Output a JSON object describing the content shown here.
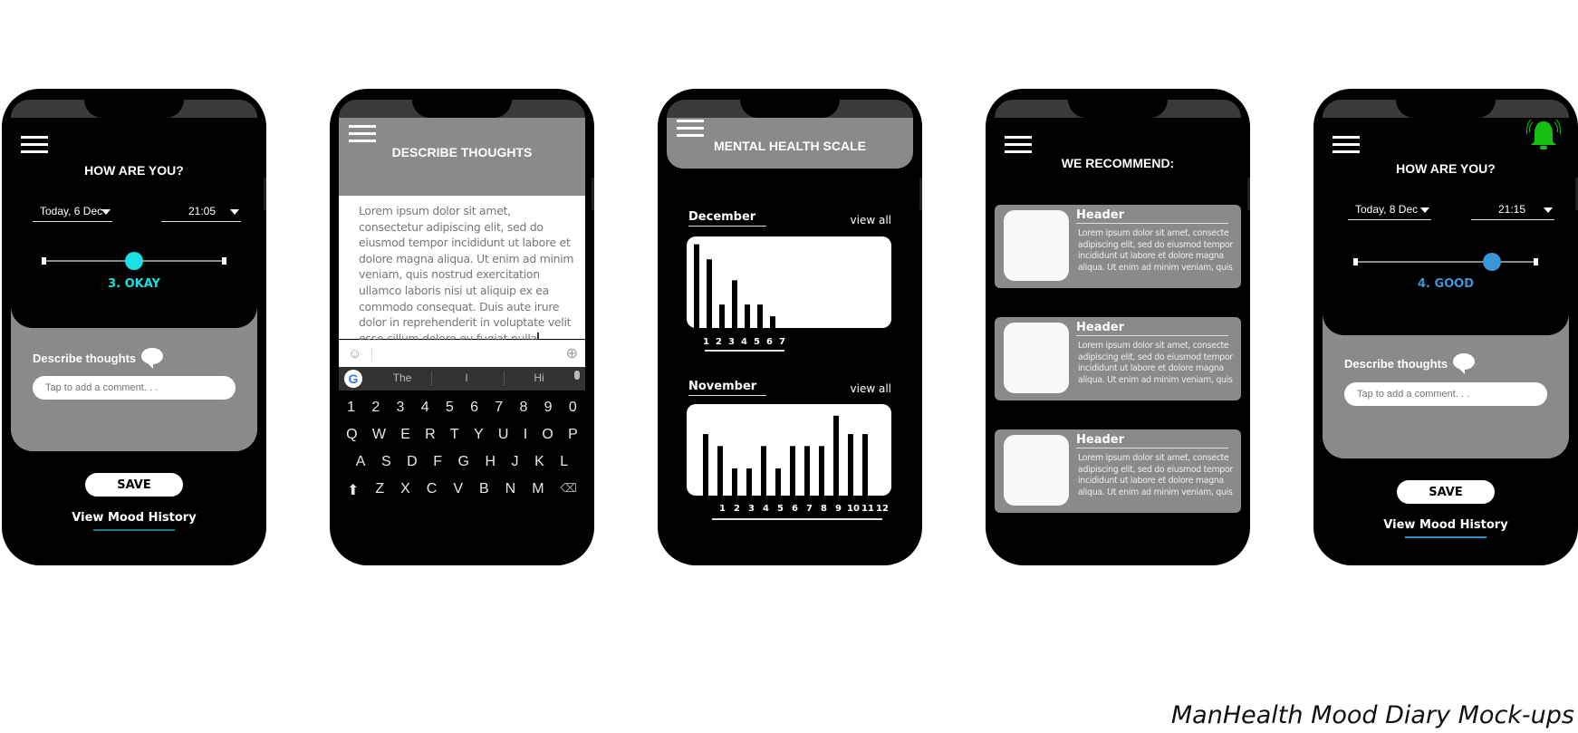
{
  "caption": "ManHealth Mood Diary Mock-ups",
  "colors": {
    "okay": "#19e0e3",
    "good": "#3b96d6",
    "bell": "#14c014",
    "okay_underline": "#1a7c8a",
    "good_underline": "#2e8fc9"
  },
  "screen1": {
    "title": "HOW ARE YOU?",
    "date": "Today, 6 Dec",
    "time": "21:05",
    "mood_level": 3,
    "mood_scale_max": 5,
    "mood_label": "3. OKAY",
    "describe_label": "Describe thoughts",
    "comment_placeholder": "Tap to add a comment. . .",
    "save_label": "SAVE",
    "history_link": "View Mood History"
  },
  "screen2": {
    "title": "DESCRIBE THOUGHTS",
    "text": "Lorem ipsum dolor sit amet, consectetur adipiscing elit, sed do eiusmod tempor incididunt ut labore et dolore magna aliqua. Ut enim ad minim veniam, quis nostrud exercitation ullamco laboris nisi ut aliquip ex ea commodo consequat. Duis aute irure dolor in reprehenderit in voluptate velit esse cillum dolore eu fugiat nulla",
    "suggestions": [
      "The",
      "I",
      "Hi"
    ],
    "keyboard_rows": [
      [
        "1",
        "2",
        "3",
        "4",
        "5",
        "6",
        "7",
        "8",
        "9",
        "0"
      ],
      [
        "Q",
        "W",
        "E",
        "R",
        "T",
        "Y",
        "U",
        "I",
        "O",
        "P"
      ],
      [
        "A",
        "S",
        "D",
        "F",
        "G",
        "H",
        "J",
        "K",
        "L"
      ],
      [
        "⬆",
        "Z",
        "X",
        "C",
        "V",
        "B",
        "N",
        "M",
        "⌫"
      ]
    ]
  },
  "screen3": {
    "title": "MENTAL HEALTH SCALE",
    "view_all": "view all"
  },
  "chart_data": [
    {
      "type": "bar",
      "title": "December",
      "categories": [
        "1",
        "2",
        "3",
        "4",
        "5",
        "6",
        "7"
      ],
      "values": [
        10,
        8.2,
        2.8,
        5.7,
        2.8,
        2.8,
        1.4
      ],
      "ylim": [
        0,
        10.5
      ],
      "xlabel": "",
      "ylabel": ""
    },
    {
      "type": "bar",
      "title": "November",
      "categories": [
        "1",
        "2",
        "3",
        "4",
        "5",
        "6",
        "7",
        "8",
        "9",
        "10",
        "11",
        "12"
      ],
      "values": [
        7.7,
        6.2,
        3.4,
        3.4,
        6.2,
        3.4,
        6.2,
        6.2,
        6.2,
        10,
        7.7,
        7.7
      ],
      "ylim": [
        0,
        11
      ],
      "xlabel": "",
      "ylabel": ""
    }
  ],
  "screen4": {
    "title": "WE RECOMMEND:",
    "cards": [
      {
        "header": "Header",
        "text": "Lorem ipsum dolor sit amet, consecte adipiscing elit, sed do eiusmod tempor incididunt ut labore et dolore magna aliqua. Ut enim ad minim veniam, quis"
      },
      {
        "header": "Header",
        "text": "Lorem ipsum dolor sit amet, consecte adipiscing elit, sed do eiusmod tempor incididunt ut labore et dolore magna aliqua. Ut enim ad minim veniam, quis"
      },
      {
        "header": "Header",
        "text": "Lorem ipsum dolor sit amet, consecte adipiscing elit, sed do eiusmod tempor incididunt ut labore et dolore magna aliqua. Ut enim ad minim veniam, quis"
      }
    ]
  },
  "screen5": {
    "title": "HOW ARE YOU?",
    "date": "Today, 8 Dec",
    "time": "21:15",
    "mood_level": 4,
    "mood_scale_max": 5,
    "mood_label": "4. GOOD",
    "describe_label": "Describe thoughts",
    "comment_placeholder": "Tap to add a comment. . .",
    "save_label": "SAVE",
    "history_link": "View Mood History"
  }
}
